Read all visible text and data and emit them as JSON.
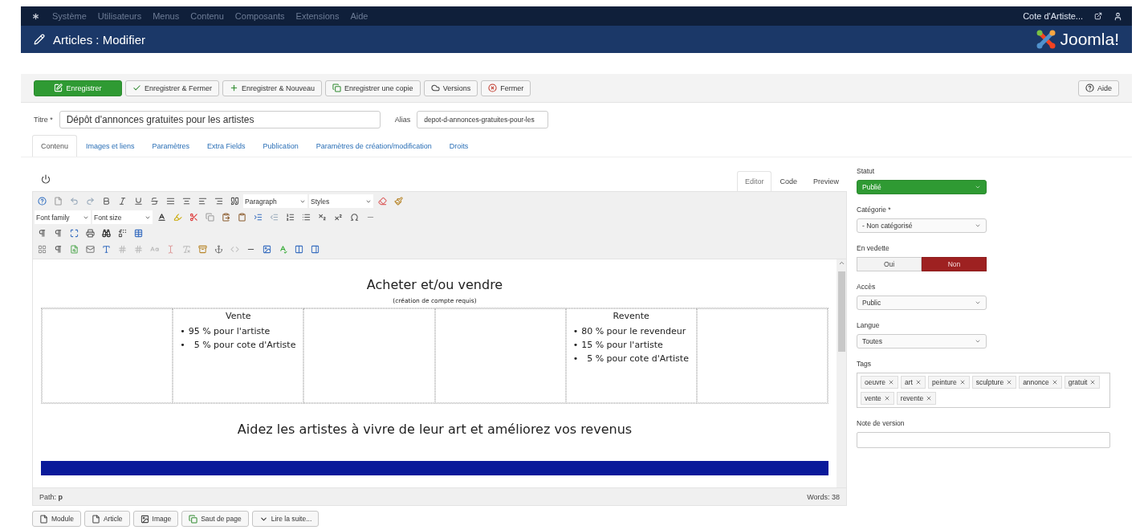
{
  "top_menu": {
    "items": [
      "Système",
      "Utilisateurs",
      "Menus",
      "Contenu",
      "Composants",
      "Extensions",
      "Aide"
    ],
    "site_link": "Cote d'Artiste..."
  },
  "header": {
    "title": "Articles : Modifier",
    "brand": "Joomla!"
  },
  "toolbar": {
    "buttons": [
      {
        "label": "Enregistrer",
        "kind": "save"
      },
      {
        "label": "Enregistrer & Fermer",
        "kind": "save-close"
      },
      {
        "label": "Enregistrer & Nouveau",
        "kind": "save-new"
      },
      {
        "label": "Enregistrer une copie",
        "kind": "copy"
      },
      {
        "label": "Versions",
        "kind": "versions"
      },
      {
        "label": "Fermer",
        "kind": "close"
      }
    ],
    "help": "Aide"
  },
  "title_field": {
    "label": "Titre *",
    "value": "Dépôt d'annonces gratuites pour les artistes"
  },
  "alias_field": {
    "label": "Alias",
    "value": "depot-d-annonces-gratuites-pour-les"
  },
  "tabs": [
    {
      "label": "Contenu",
      "selected": true
    },
    {
      "label": "Images et liens",
      "selected": false
    },
    {
      "label": "Paramètres",
      "selected": false
    },
    {
      "label": "Extra Fields",
      "selected": false
    },
    {
      "label": "Publication",
      "selected": false
    },
    {
      "label": "Paramètres de création/modification",
      "selected": false
    },
    {
      "label": "Droits",
      "selected": false
    }
  ],
  "editor": {
    "view_tabs": [
      {
        "label": "Editor",
        "selected": true
      },
      {
        "label": "Code",
        "selected": false
      },
      {
        "label": "Preview",
        "selected": false
      }
    ],
    "block_format": "Paragraph",
    "styles": "Styles",
    "font_family": "Font family",
    "font_size": "Font size",
    "content": {
      "heading": "Acheter et/ou vendre",
      "note": "(création de compte requis)",
      "cells": [
        {
          "kind": "empty"
        },
        {
          "kind": "list",
          "title": "Vente",
          "items": [
            {
              "marker": "•",
              "text": "95 % pour l'artiste"
            },
            {
              "marker": "•",
              "text": "  5 % pour cote d'Artiste"
            }
          ]
        },
        {
          "kind": "empty"
        },
        {
          "kind": "empty"
        },
        {
          "kind": "list",
          "title": "Revente",
          "items": [
            {
              "marker": "•",
              "text": "80 % pour le revendeur"
            },
            {
              "marker": "•",
              "text": "15 % pour l'artiste"
            },
            {
              "marker": "•",
              "text": "  5 % pour cote d'Artiste"
            }
          ]
        },
        {
          "kind": "empty"
        }
      ],
      "tagline": "Aidez les artistes à vivre de leur art et améliorez vos revenus"
    },
    "path_label": "Path:",
    "path": "p",
    "words": "Words: 38"
  },
  "editor_buttons": [
    {
      "label": "Module",
      "kind": "document"
    },
    {
      "label": "Article",
      "kind": "document"
    },
    {
      "label": "Image",
      "kind": "image"
    },
    {
      "label": "Saut de page",
      "kind": "copy"
    },
    {
      "label": "Lire la suite...",
      "kind": "chevron"
    }
  ],
  "sidebar": {
    "status": {
      "label": "Statut",
      "value": "Publié"
    },
    "category": {
      "label": "Catégorie *",
      "value": "- Non catégorisé"
    },
    "featured": {
      "label": "En vedette",
      "options": [
        {
          "label": "Oui",
          "selected": false
        },
        {
          "label": "Non",
          "selected": true
        }
      ]
    },
    "access": {
      "label": "Accès",
      "value": "Public"
    },
    "language": {
      "label": "Langue",
      "value": "Toutes"
    },
    "tags": {
      "label": "Tags",
      "items": [
        "oeuvre",
        "art",
        "peinture",
        "sculpture",
        "annonce",
        "gratuit",
        "vente",
        "revente"
      ]
    },
    "version_note": {
      "label": "Note de version"
    }
  }
}
